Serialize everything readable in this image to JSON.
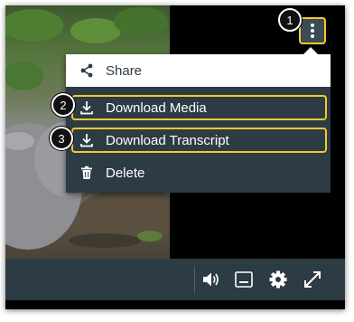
{
  "menu": {
    "items": [
      {
        "label": "Share",
        "icon": "share-icon"
      },
      {
        "label": "Download Media",
        "icon": "download-icon"
      },
      {
        "label": "Download Transcript",
        "icon": "download-icon"
      },
      {
        "label": "Delete",
        "icon": "trash-icon"
      }
    ]
  },
  "callouts": [
    "1",
    "2",
    "3"
  ],
  "controls": {
    "icons": [
      "volume-icon",
      "captions-icon",
      "settings-icon",
      "fullscreen-icon"
    ]
  },
  "colors": {
    "highlight": "#f7c92c",
    "menu_bg": "#2d3b45",
    "active_item_bg": "#ffffff"
  }
}
